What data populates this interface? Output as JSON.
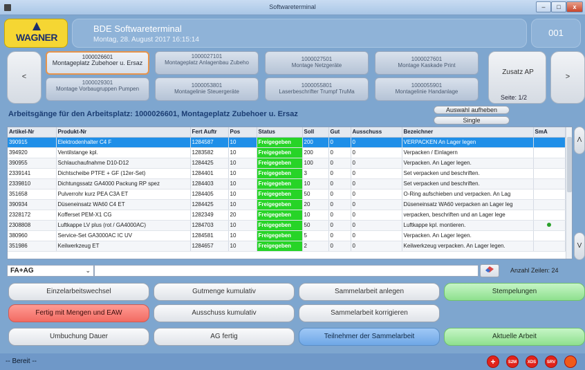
{
  "window": {
    "title": "Softwareterminal",
    "min": "–",
    "max": "□",
    "close": "x"
  },
  "header": {
    "logo": "WAGNER",
    "title": "BDE Softwareterminal",
    "datetime": "Montag, 28. August 2017 16:15:14",
    "terminal": "001"
  },
  "workplaces": {
    "prev": "<",
    "next": ">",
    "items": [
      {
        "id": "1000026601",
        "name": "Montageplatz Zubehoer u. Ersaz"
      },
      {
        "id": "1000027101",
        "name": "Montageplatz Anlagenbau Zubeho"
      },
      {
        "id": "1000027501",
        "name": "Montage Netzgeräte"
      },
      {
        "id": "1000027601",
        "name": "Montage Kaskade Print"
      },
      {
        "id": "1000029301",
        "name": "Montage Vorbaugruppen Pumpen"
      },
      {
        "id": "1000053801",
        "name": "Montagelinie Steuergeräte"
      },
      {
        "id": "1000055801",
        "name": "Laserbeschrifter Trumpf TruMa"
      },
      {
        "id": "1000055901",
        "name": "Montagelinie Handanlage"
      }
    ],
    "zusatz": "Zusatz AP",
    "page": "Seite: 1/2"
  },
  "section": {
    "title": "Arbeitsgänge für den Arbeitsplatz: 1000026601, Montageplatz Zubehoer u. Ersaz",
    "clear_selection": "Auswahl aufheben",
    "single": "Single"
  },
  "table": {
    "columns": [
      "Artikel-Nr",
      "Produkt-Nr",
      "Fert Auftr",
      "Pos",
      "Status",
      "Soll",
      "Gut",
      "Ausschuss",
      "Bezeichner",
      "SmA"
    ],
    "rows": [
      [
        "390915",
        "Elektrodenhalter C4 F",
        "1284587",
        "10",
        "Freigegeben",
        "200",
        "0",
        "0",
        "VERPACKEN An Lager legen",
        ""
      ],
      [
        "394920",
        "Ventilstange kpl.",
        "1283582",
        "10",
        "Freigegeben",
        "200",
        "0",
        "0",
        "Verpacken / Einlagern",
        ""
      ],
      [
        "390955",
        "Schlauchaufnahme D10-D12",
        "1284425",
        "10",
        "Freigegeben",
        "100",
        "0",
        "0",
        "Verpacken. An Lager legen.",
        ""
      ],
      [
        "2339141",
        "Dichtscheibe PTFE + GF (12er-Set)",
        "1284401",
        "10",
        "Freigegeben",
        "3",
        "0",
        "0",
        "Set verpacken und beschriften.",
        ""
      ],
      [
        "2339810",
        "Dichtungssatz GA4000 Packung RP spez",
        "1284403",
        "10",
        "Freigegeben",
        "10",
        "0",
        "0",
        "Set verpacken und beschriften.",
        ""
      ],
      [
        "351658",
        "Pulverrohr kurz PEA C3A ET",
        "1284405",
        "10",
        "Freigegeben",
        "50",
        "0",
        "0",
        "O-Ring aufschieben und verpacken. An Lag",
        ""
      ],
      [
        "390934",
        "Düseneinsatz WA60 C4 ET",
        "1284425",
        "10",
        "Freigegeben",
        "20",
        "0",
        "0",
        "Düseneinsatz WA60 verpacken an Lager leg",
        ""
      ],
      [
        "2328172",
        "Kofferset PEM-X1 CG",
        "1282349",
        "20",
        "Freigegeben",
        "10",
        "0",
        "0",
        "verpacken, beschriften und an Lager lege",
        ""
      ],
      [
        "2308808",
        "Luftkappe LV plus (rot / GA4000AC)",
        "1284703",
        "10",
        "Freigegeben",
        "50",
        "0",
        "0",
        "Luftkappe kpl. montieren.",
        "dot"
      ],
      [
        "380960",
        "Service-Set GA3000AC IC UV",
        "1284581",
        "10",
        "Freigegeben",
        "5",
        "0",
        "0",
        "Verpacken. An Lager legen.",
        ""
      ],
      [
        "351986",
        "Keilwerkzeug ET",
        "1284657",
        "10",
        "Freigegeben",
        "2",
        "0",
        "0",
        "Keilwerkzeug verpacken. An Lager legen.",
        ""
      ]
    ],
    "up": "Λ",
    "down": "V"
  },
  "filter": {
    "mode": "FA+AG",
    "caret": "⌄",
    "value": "",
    "rows_count": "Anzahl Zeilen: 24"
  },
  "actions": {
    "einzel": "Einzelarbeitswechsel",
    "gutmenge": "Gutmenge kumulativ",
    "sammel_anlegen": "Sammelarbeit anlegen",
    "stempelungen": "Stempelungen",
    "fertig_mengen": "Fertig mit Mengen und EAW",
    "ausschuss": "Ausschuss kumulativ",
    "sammel_korrigieren": "Sammelarbeit korrigieren",
    "umbuchung": "Umbuchung Dauer",
    "ag_fertig": "AG fertig",
    "teilnehmer": "Teilnehmer der Sammelarbeit",
    "aktuelle": "Aktuelle Arbeit"
  },
  "status": {
    "text": "-- Bereit --",
    "icons": [
      "+",
      "S2M",
      "XDS",
      "SRV",
      ""
    ]
  },
  "colors": {
    "selected_row": "#1f8fe8",
    "status_green": "#27d427",
    "header_blue": "#8fb3d8",
    "brand_yellow": "#f5d633"
  }
}
